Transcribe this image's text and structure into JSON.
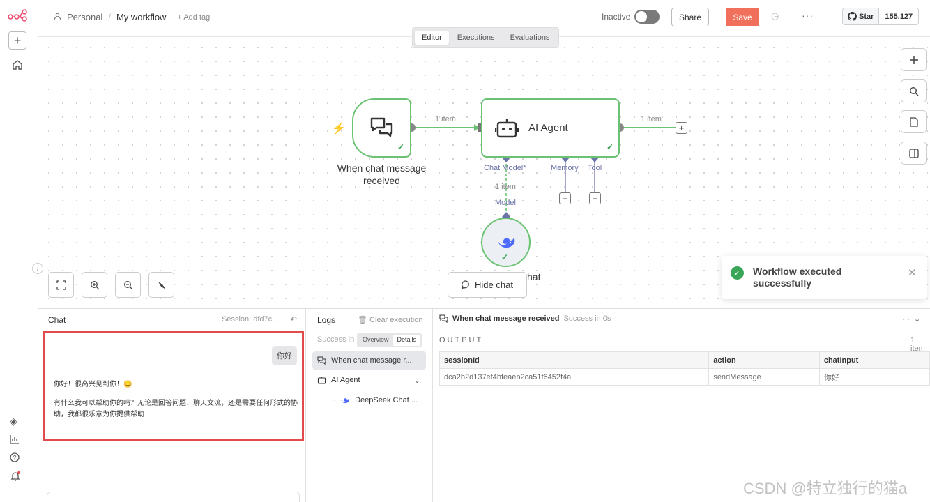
{
  "breadcrumb": {
    "project": "Personal",
    "separator": "/",
    "workflow": "My workflow",
    "add_tag": "+ Add tag"
  },
  "header": {
    "status_label": "Inactive",
    "share": "Share",
    "save": "Save",
    "more": "···",
    "github_star": "Star",
    "github_count": "155,127"
  },
  "tabs": [
    {
      "label": "Editor",
      "active": true
    },
    {
      "label": "Executions",
      "active": false
    },
    {
      "label": "Evaluations",
      "active": false
    }
  ],
  "nodes": {
    "trigger": {
      "label": "When chat message received"
    },
    "agent": {
      "label": "AI Agent"
    },
    "conn_items": [
      "1 item",
      "1 item",
      "1 item"
    ],
    "sub_chat_model": "Chat Model*",
    "sub_memory": "Memory",
    "sub_tool": "Tool",
    "model_label": "Model",
    "deepseek_partial": "hat"
  },
  "canvas_controls": {
    "hide_chat": "Hide chat"
  },
  "toast": {
    "message": "Workflow executed successfully"
  },
  "chat": {
    "title": "Chat",
    "session": "Session: dfd7c...",
    "user_message": "你好",
    "bot_line1": "你好！很高兴见到你！😊",
    "bot_line2": "有什么我可以帮助你的吗？无论是回答问题、聊天交流，还是需要任何形式的协助，我都很乐意为你提供帮助！"
  },
  "logs": {
    "title": "Logs",
    "clear": "Clear execution",
    "success": "Success in",
    "overview": "Overview",
    "details": "Details",
    "rows": [
      {
        "label": "When chat message r...",
        "selected": true
      },
      {
        "label": "AI Agent",
        "selected": false
      },
      {
        "label": "DeepSeek Chat ...",
        "selected": false
      }
    ]
  },
  "output": {
    "node": "When chat message received",
    "status": "Success in 0s",
    "label": "OUTPUT",
    "count": "1 item",
    "columns": [
      "sessionId",
      "action",
      "chatInput"
    ],
    "rows": [
      [
        "dca2b2d137ef4bfeaeb2ca51f6452f4a",
        "sendMessage",
        "你好"
      ]
    ]
  },
  "watermark": "CSDN @特立独行的猫a",
  "colors": {
    "accent": "#f0705b",
    "success": "#3aa657",
    "node_border": "#6ac272",
    "highlight": "#e24b4b"
  }
}
